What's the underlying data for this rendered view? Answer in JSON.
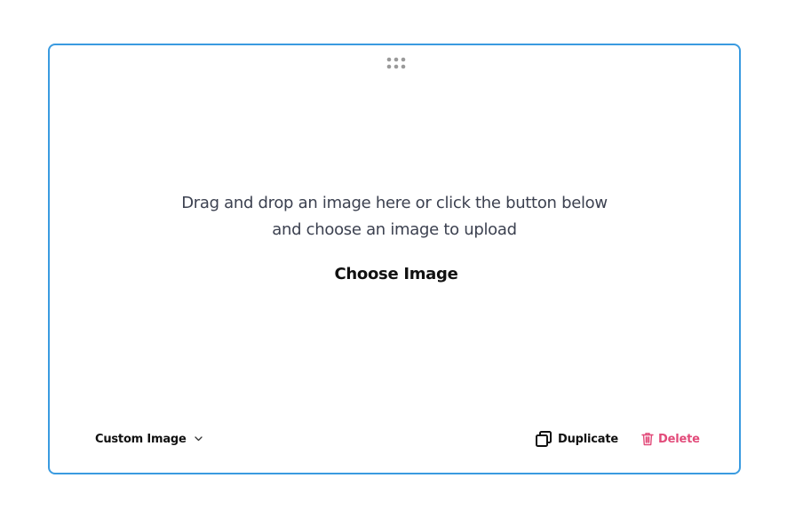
{
  "upload_block": {
    "instructions_line1": "Drag and drop an image here or click the button below",
    "instructions_line2": "and choose an image to upload",
    "choose_label": "Choose Image"
  },
  "footer": {
    "type_select_value": "Custom Image",
    "duplicate_label": "Duplicate",
    "delete_label": "Delete"
  },
  "icons": {
    "drag_handle": "grip-dots-icon",
    "type_select": "chevron-down-icon",
    "duplicate": "copy-icon",
    "delete": "trash-icon"
  },
  "colors": {
    "card_border": "#3a9be0",
    "delete_accent": "#e24b7a",
    "text_primary": "#111111",
    "text_secondary": "#3c4150",
    "handle_dots": "#9a9a9a"
  }
}
